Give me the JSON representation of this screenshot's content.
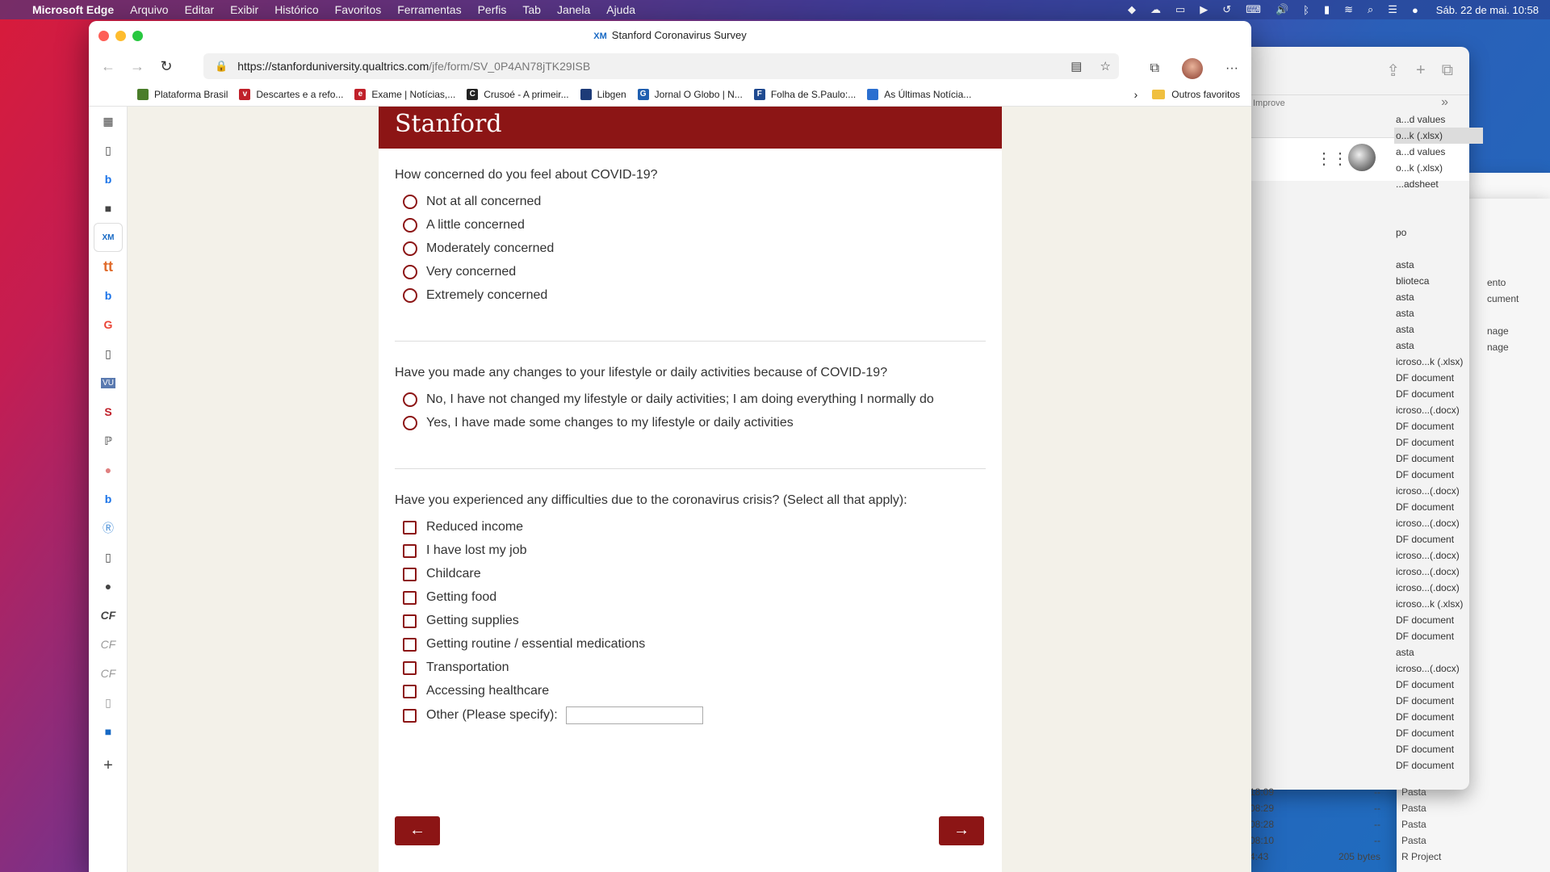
{
  "menubar": {
    "apple": "",
    "app": "Microsoft Edge",
    "items": [
      "Arquivo",
      "Editar",
      "Exibir",
      "Histórico",
      "Favoritos",
      "Ferramentas",
      "Perfis",
      "Tab",
      "Janela",
      "Ajuda"
    ],
    "clock": "Sáb. 22 de mai.  10:58"
  },
  "window": {
    "title_badge": "XM",
    "title": "Stanford Coronavirus Survey",
    "url_host": "https://stanforduniversity.qualtrics.com",
    "url_path": "/jfe/form/SV_0P4AN78jTK29ISB"
  },
  "bookmarks": [
    {
      "label": "Plataforma Brasil",
      "color": "#4a7d2a",
      "glyph": ""
    },
    {
      "label": "Descartes e a refo...",
      "color": "#c0202a",
      "glyph": "v"
    },
    {
      "label": "Exame | Notícias,...",
      "color": "#c0202a",
      "glyph": "e"
    },
    {
      "label": "Crusoé - A primeir...",
      "color": "#222222",
      "glyph": "C"
    },
    {
      "label": "Libgen",
      "color": "#1d3b78",
      "glyph": ""
    },
    {
      "label": "Jornal O Globo | N...",
      "color": "#1f5fb0",
      "glyph": "G"
    },
    {
      "label": "Folha de S.Paulo:...",
      "color": "#1f4a90",
      "glyph": "F"
    },
    {
      "label": "As Últimas Notícia...",
      "color": "#2b6fd0",
      "glyph": ""
    }
  ],
  "bookmarks_other": "Outros favoritos",
  "survey": {
    "brand": "Stanford",
    "q1": {
      "text": "How concerned do you feel about COVID-19?",
      "options": [
        "Not at all concerned",
        "A little concerned",
        "Moderately concerned",
        "Very concerned",
        "Extremely concerned"
      ]
    },
    "q2": {
      "text": "Have you made any changes to your lifestyle or daily activities because of COVID-19?",
      "options": [
        "No, I have not changed my lifestyle or daily activities; I am doing everything I normally do",
        "Yes, I have made some changes to my lifestyle or daily activities"
      ]
    },
    "q3": {
      "text": "Have you experienced any difficulties due to the coronavirus crisis? (Select all that apply):",
      "options": [
        "Reduced income",
        "I have lost my job",
        "Childcare",
        "Getting food",
        "Getting supplies",
        "Getting routine / essential medications",
        "Transportation",
        "Accessing healthcare",
        "Other (Please specify):"
      ]
    },
    "back": "←",
    "next": "→"
  },
  "finder": {
    "list": [
      "a...d values",
      "o...k (.xlsx)",
      "a...d values",
      "o...k (.xlsx)",
      "...adsheet",
      "",
      "",
      "po",
      "",
      "asta",
      "blioteca",
      "asta",
      "asta",
      "asta",
      "asta",
      "icroso...k (.xlsx)",
      "DF document",
      "DF document",
      "icroso...(.docx)",
      "DF document",
      "DF document",
      "DF document",
      "DF document",
      "icroso...(.docx)",
      "DF document",
      "icroso...(.docx)",
      "DF document",
      "icroso...(.docx)",
      "icroso...(.docx)",
      "icroso...(.docx)",
      "icroso...k (.xlsx)",
      "DF document",
      "DF document",
      "asta",
      "icroso...(.docx)",
      "DF document",
      "DF document",
      "DF document",
      "DF document",
      "DF document",
      "DF document"
    ],
    "right": [
      "ento",
      "cument",
      "",
      "nage",
      "nage"
    ],
    "bottom": [
      {
        "time": "18:09",
        "size": "--",
        "kind": "Pasta"
      },
      {
        "time": "08:29",
        "size": "--",
        "kind": "Pasta"
      },
      {
        "time": "08:28",
        "size": "--",
        "kind": "Pasta"
      },
      {
        "time": "08:10",
        "size": "--",
        "kind": "Pasta"
      },
      {
        "time": "4:43",
        "size": "205 bytes",
        "kind": "R Project"
      }
    ],
    "improve": "Improve",
    "hint": "eylent..."
  },
  "colors": {
    "stanford_red": "#8c1515",
    "page_bg": "#f3f1e9"
  }
}
